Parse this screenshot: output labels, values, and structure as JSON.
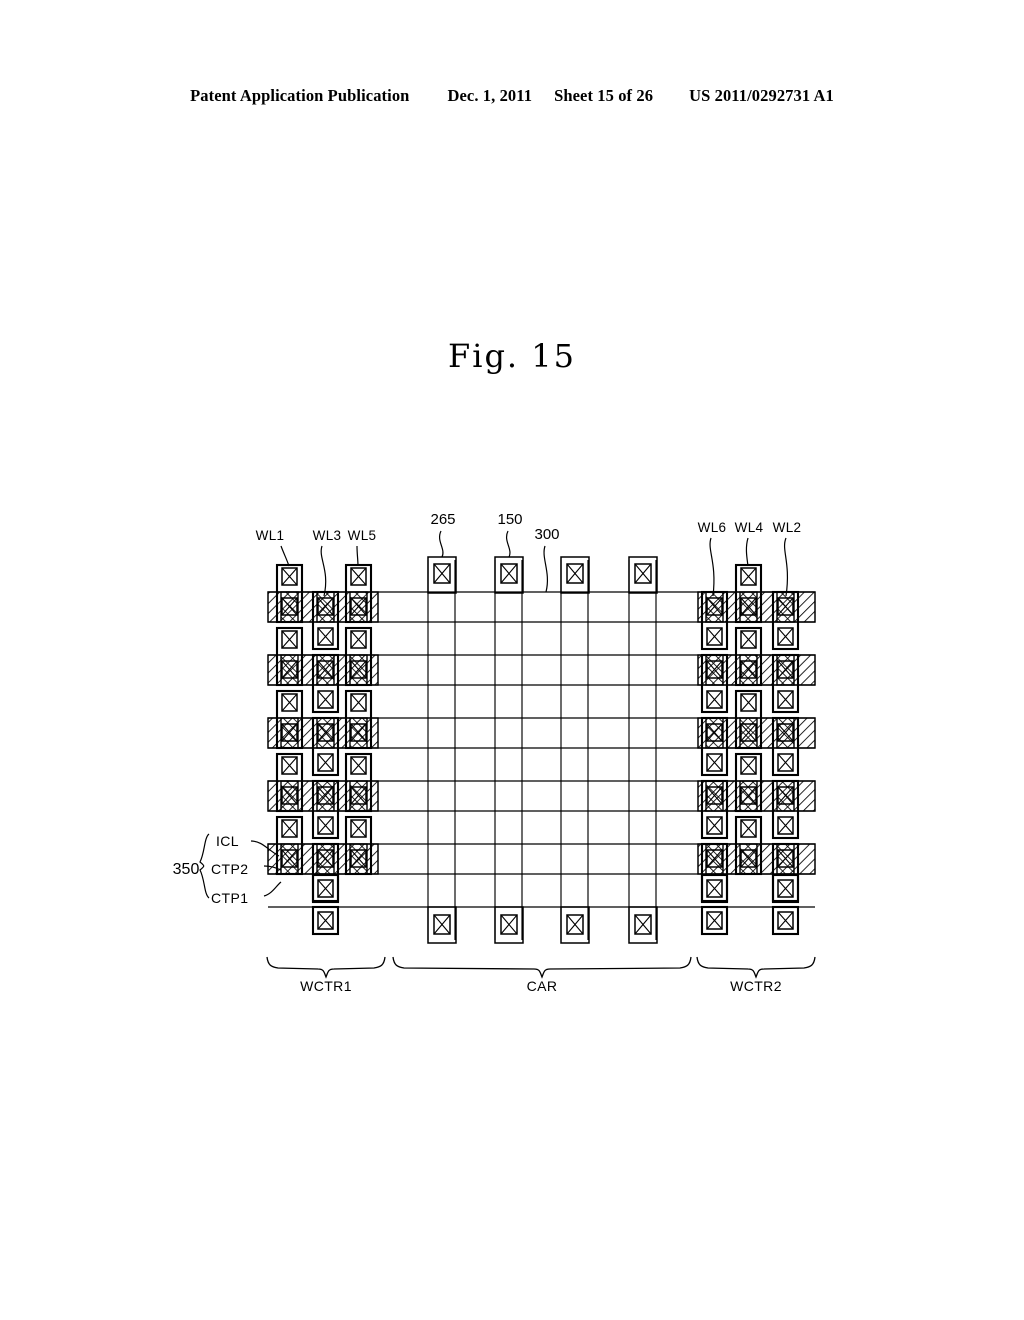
{
  "header": {
    "publication": "Patent Application Publication",
    "date": "Dec. 1, 2011",
    "sheet": "Sheet 15 of 26",
    "patent_number": "US 2011/0292731 A1"
  },
  "figure": {
    "title": "Fig. 15",
    "top_left_labels": [
      "WL1",
      "WL3",
      "WL5"
    ],
    "top_right_labels": [
      "WL6",
      "WL4",
      "WL2"
    ],
    "callouts": [
      "265",
      "150",
      "300"
    ],
    "group_ref": "350",
    "group_members": [
      "ICL",
      "CTP2",
      "CTP1"
    ],
    "regions": [
      "WCTR1",
      "CAR",
      "WCTR2"
    ]
  },
  "colors": {
    "ink": "#000000",
    "paper": "#ffffff",
    "hatch": "#000000"
  }
}
